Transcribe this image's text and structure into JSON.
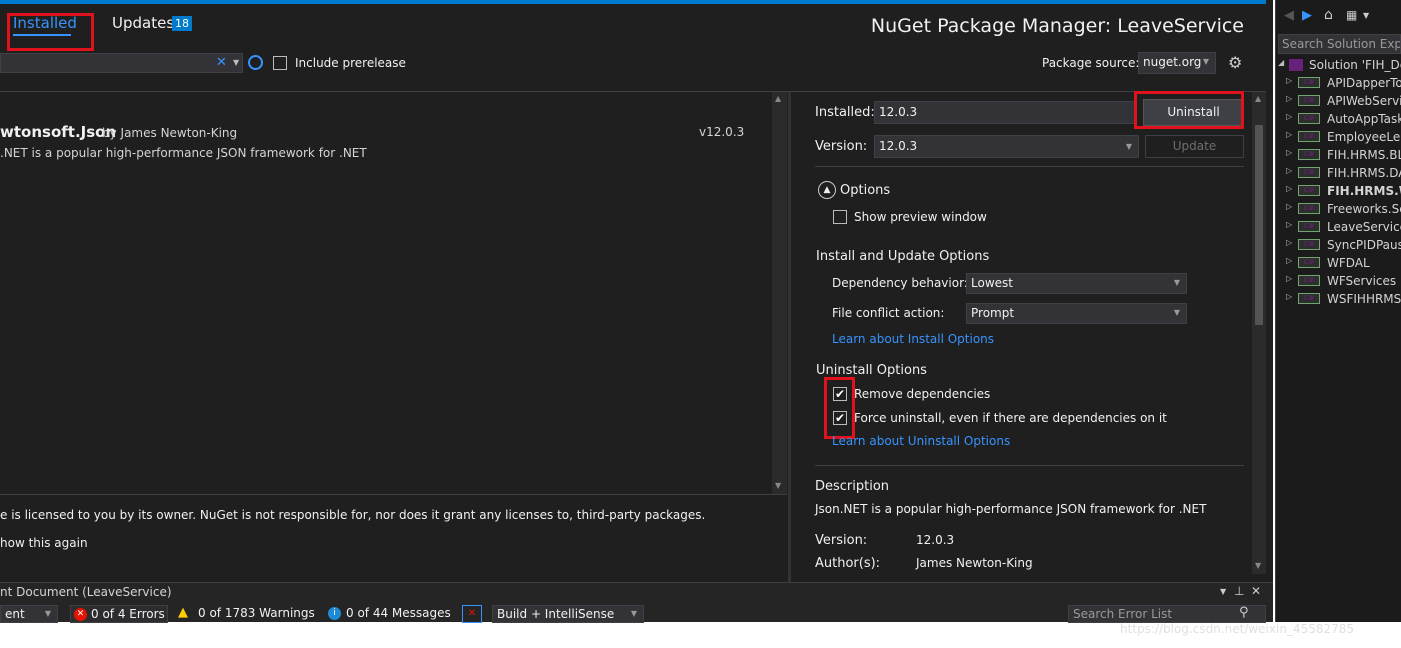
{
  "header": {
    "tab_installed": "Installed",
    "tab_updates": "Updates",
    "updates_count": "18",
    "title": "NuGet Package Manager: LeaveService",
    "include_prerelease": "Include prerelease",
    "package_source_label": "Package source:",
    "package_source_value": "nuget.org"
  },
  "package_list": {
    "items": [
      {
        "name": "wtonsoft.Json",
        "author": "by James Newton-King",
        "version": "v12.0.3",
        "description": ".NET is a popular high-performance JSON framework for .NET"
      }
    ],
    "license_text": "e is licensed to you by its owner. NuGet is not responsible for, nor does it grant any licenses to, third-party packages.",
    "dont_show": "how this again"
  },
  "details": {
    "installed_label": "Installed:",
    "installed_value": "12.0.3",
    "uninstall_button": "Uninstall",
    "version_label": "Version:",
    "version_value": "12.0.3",
    "update_button": "Update",
    "options_label": "Options",
    "show_preview": "Show preview window",
    "install_update_heading": "Install and Update Options",
    "dependency_label": "Dependency behavior:",
    "dependency_value": "Lowest",
    "conflict_label": "File conflict action:",
    "conflict_value": "Prompt",
    "learn_install": "Learn about Install Options",
    "uninstall_heading": "Uninstall Options",
    "remove_deps": "Remove dependencies",
    "force_uninstall": "Force uninstall, even if there are dependencies on it",
    "learn_uninstall": "Learn about Uninstall Options",
    "description_heading": "Description",
    "description_text": "Json.NET is a popular high-performance JSON framework for .NET",
    "version2_label": "Version:",
    "version2_value": "12.0.3",
    "authors_label": "Author(s):",
    "authors_value": "James Newton-King"
  },
  "error_list": {
    "title": "nt Document (LeaveService)",
    "scope": "ent",
    "errors": "0 of 4 Errors",
    "warnings": "0 of 1783 Warnings",
    "messages": "0 of 44 Messages",
    "build_filter": "Build + IntelliSense",
    "search_placeholder": "Search Error List"
  },
  "solution_explorer": {
    "search_placeholder": "Search Solution Explo",
    "solution": "Solution 'FIH_De",
    "projects": [
      {
        "name": "APIDapperTo",
        "bold": false
      },
      {
        "name": "APIWebServic",
        "bold": false
      },
      {
        "name": "AutoAppTask",
        "bold": false
      },
      {
        "name": "EmployeeLea",
        "bold": false
      },
      {
        "name": "FIH.HRMS.BL",
        "bold": false
      },
      {
        "name": "FIH.HRMS.DA",
        "bold": false
      },
      {
        "name": "FIH.HRMS.W",
        "bold": true
      },
      {
        "name": "Freeworks.Se",
        "bold": false
      },
      {
        "name": "LeaveService",
        "bold": false
      },
      {
        "name": "SyncPIDPause",
        "bold": false
      },
      {
        "name": "WFDAL",
        "bold": false
      },
      {
        "name": "WFServices",
        "bold": false
      },
      {
        "name": "WSFIHHRMS",
        "bold": false
      }
    ]
  },
  "watermark": "https://blog.csdn.net/weixin_45582785",
  "colors": {
    "accent": "#007acc",
    "highlight_box": "#e0121b",
    "link": "#3794ff",
    "background": "#1f1f1f"
  }
}
